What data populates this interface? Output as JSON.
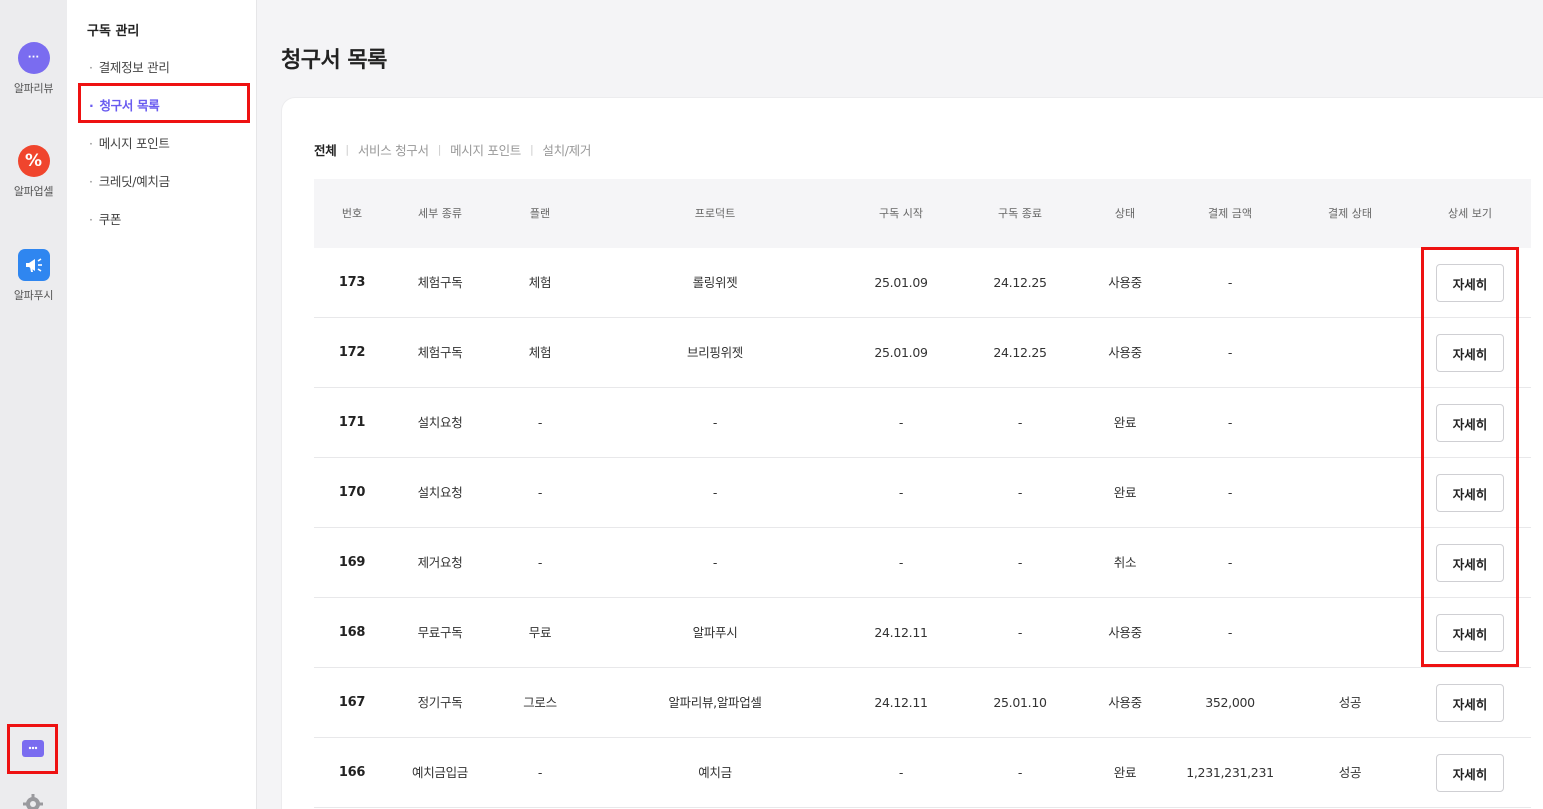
{
  "rail": {
    "items": [
      {
        "label": "알파리뷰",
        "color": "#7a6cf0"
      },
      {
        "label": "알파업셀",
        "color": "#f0452d"
      },
      {
        "label": "알파푸시",
        "color": "#2f86f0"
      }
    ],
    "percent_glyph": "%",
    "bubble_glyph": "···"
  },
  "submenu": {
    "title": "구독 관리",
    "items": [
      {
        "label": "결제정보 관리"
      },
      {
        "label": "청구서 목록"
      },
      {
        "label": "메시지 포인트"
      },
      {
        "label": "크레딧/예치금"
      },
      {
        "label": "쿠폰"
      }
    ],
    "dot": "·"
  },
  "main": {
    "title": "청구서 목록",
    "tabs": [
      "전체",
      "서비스 청구서",
      "메시지 포인트",
      "설치/제거"
    ],
    "tab_separator": "|"
  },
  "table": {
    "columns": [
      "번호",
      "세부 종류",
      "플랜",
      "프로덕트",
      "구독 시작",
      "구독 종료",
      "상태",
      "결제 금액",
      "결제 상태",
      "상세 보기"
    ],
    "button_label": "자세히",
    "rows": [
      {
        "no": "173",
        "kind": "체험구독",
        "plan": "체험",
        "product": "롤링위젯",
        "start": "25.01.09",
        "end": "24.12.25",
        "status": "사용중",
        "amount": "-",
        "pay_status": ""
      },
      {
        "no": "172",
        "kind": "체험구독",
        "plan": "체험",
        "product": "브리핑위젯",
        "start": "25.01.09",
        "end": "24.12.25",
        "status": "사용중",
        "amount": "-",
        "pay_status": ""
      },
      {
        "no": "171",
        "kind": "설치요청",
        "plan": "-",
        "product": "-",
        "start": "-",
        "end": "-",
        "status": "완료",
        "amount": "-",
        "pay_status": ""
      },
      {
        "no": "170",
        "kind": "설치요청",
        "plan": "-",
        "product": "-",
        "start": "-",
        "end": "-",
        "status": "완료",
        "amount": "-",
        "pay_status": ""
      },
      {
        "no": "169",
        "kind": "제거요청",
        "plan": "-",
        "product": "-",
        "start": "-",
        "end": "-",
        "status": "취소",
        "amount": "-",
        "pay_status": ""
      },
      {
        "no": "168",
        "kind": "무료구독",
        "plan": "무료",
        "product": "알파푸시",
        "start": "24.12.11",
        "end": "-",
        "status": "사용중",
        "amount": "-",
        "pay_status": ""
      },
      {
        "no": "167",
        "kind": "정기구독",
        "plan": "그로스",
        "product": "알파리뷰,알파업셀",
        "start": "24.12.11",
        "end": "25.01.10",
        "status": "사용중",
        "amount": "352,000",
        "pay_status": "성공"
      },
      {
        "no": "166",
        "kind": "예치금입금",
        "plan": "-",
        "product": "예치금",
        "start": "-",
        "end": "-",
        "status": "완료",
        "amount": "1,231,231,231",
        "pay_status": "성공"
      }
    ]
  }
}
